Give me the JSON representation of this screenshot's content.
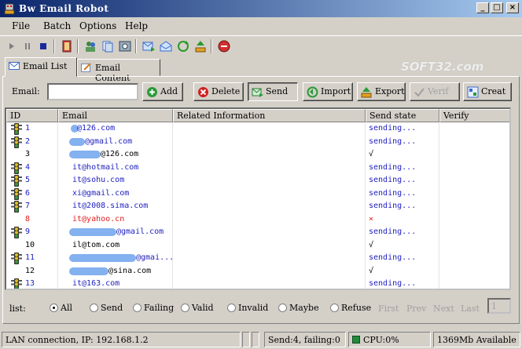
{
  "window": {
    "title": "Bw Email Robot",
    "min": "_",
    "max": "□",
    "close": "×"
  },
  "menu": [
    "File",
    "Batch",
    "Options",
    "Help"
  ],
  "toolbar": {
    "icons": [
      "play-icon",
      "pause-icon",
      "stop-icon",
      "exit-door-icon",
      "user-group-icon",
      "copy-icon",
      "settings-icon",
      "mail-send-icon",
      "mail-open-icon",
      "refresh-icon",
      "upload-icon",
      "stop-sign-icon"
    ]
  },
  "watermark": "SOFT32.com",
  "tabs": [
    {
      "label": "Email List",
      "active": true
    },
    {
      "label": "Email Content",
      "active": false
    }
  ],
  "controls": {
    "email_label": "Email:",
    "email_value": "",
    "buttons": [
      {
        "label": "Add",
        "icon": "add-icon",
        "state": "normal"
      },
      {
        "label": "Delete",
        "icon": "delete-icon",
        "state": "normal"
      },
      {
        "label": "Send",
        "icon": "send-icon",
        "state": "pressed"
      },
      {
        "label": "Import",
        "icon": "import-icon",
        "state": "normal"
      },
      {
        "label": "Export",
        "icon": "export-icon",
        "state": "normal"
      },
      {
        "label": "Verif",
        "icon": "verify-icon",
        "state": "disabled"
      },
      {
        "label": "Creat",
        "icon": "create-icon",
        "state": "normal"
      }
    ]
  },
  "grid": {
    "columns": [
      "ID",
      "Email",
      "Related Information",
      "Send  state",
      "Verify"
    ],
    "rows": [
      {
        "id": "1",
        "email": "@126.com",
        "related": "",
        "state": "sending...",
        "verify": "",
        "status": "sending"
      },
      {
        "id": "2",
        "email": "@gmail.com",
        "related": "",
        "state": "sending...",
        "verify": "",
        "status": "sending"
      },
      {
        "id": "3",
        "email": "@126.com",
        "related": "",
        "state": "√",
        "verify": "",
        "status": "ok"
      },
      {
        "id": "4",
        "email": "it@hotmail.com",
        "related": "",
        "state": "sending...",
        "verify": "",
        "status": "sending"
      },
      {
        "id": "5",
        "email": "it@sohu.com",
        "related": "",
        "state": "sending...",
        "verify": "",
        "status": "sending"
      },
      {
        "id": "6",
        "email": "xi@gmail.com",
        "related": "",
        "state": "sending...",
        "verify": "",
        "status": "sending"
      },
      {
        "id": "7",
        "email": "it@2008.sima.com",
        "related": "",
        "state": "sending...",
        "verify": "",
        "status": "sending"
      },
      {
        "id": "8",
        "email": "it@yahoo.cn",
        "related": "",
        "state": "×",
        "verify": "",
        "status": "fail"
      },
      {
        "id": "9",
        "email": "@gmail.com",
        "related": "",
        "state": "sending...",
        "verify": "",
        "status": "sending"
      },
      {
        "id": "10",
        "email": "il@tom.com",
        "related": "",
        "state": "√",
        "verify": "",
        "status": "ok"
      },
      {
        "id": "11",
        "email": "@gmai...",
        "related": "",
        "state": "sending...",
        "verify": "",
        "status": "sending"
      },
      {
        "id": "12",
        "email": "@sina.com",
        "related": "",
        "state": "√",
        "verify": "",
        "status": "ok"
      },
      {
        "id": "13",
        "email": "it@163.com",
        "related": "",
        "state": "sending...",
        "verify": "",
        "status": "sending"
      }
    ]
  },
  "filter": {
    "label": "list:",
    "options": [
      {
        "label": "All",
        "checked": true
      },
      {
        "label": "Send",
        "checked": false
      },
      {
        "label": "Failing",
        "checked": false
      },
      {
        "label": "Valid",
        "checked": false
      },
      {
        "label": "Invalid",
        "checked": false
      },
      {
        "label": "Maybe",
        "checked": false
      },
      {
        "label": "Refuse",
        "checked": false
      }
    ],
    "pager": [
      "First",
      "Prev",
      "Next",
      "Last"
    ],
    "page_value": "1"
  },
  "status": {
    "connection": "LAN connection, IP: 192.168.1.2",
    "send_info": "Send:4, failing:0",
    "cpu": "CPU:0%",
    "memory": "1369Mb Available"
  },
  "colors": {
    "titlebar_start": "#0a246a",
    "sending": "#2020c0",
    "fail": "#e02020",
    "face": "#d4d0c8"
  }
}
